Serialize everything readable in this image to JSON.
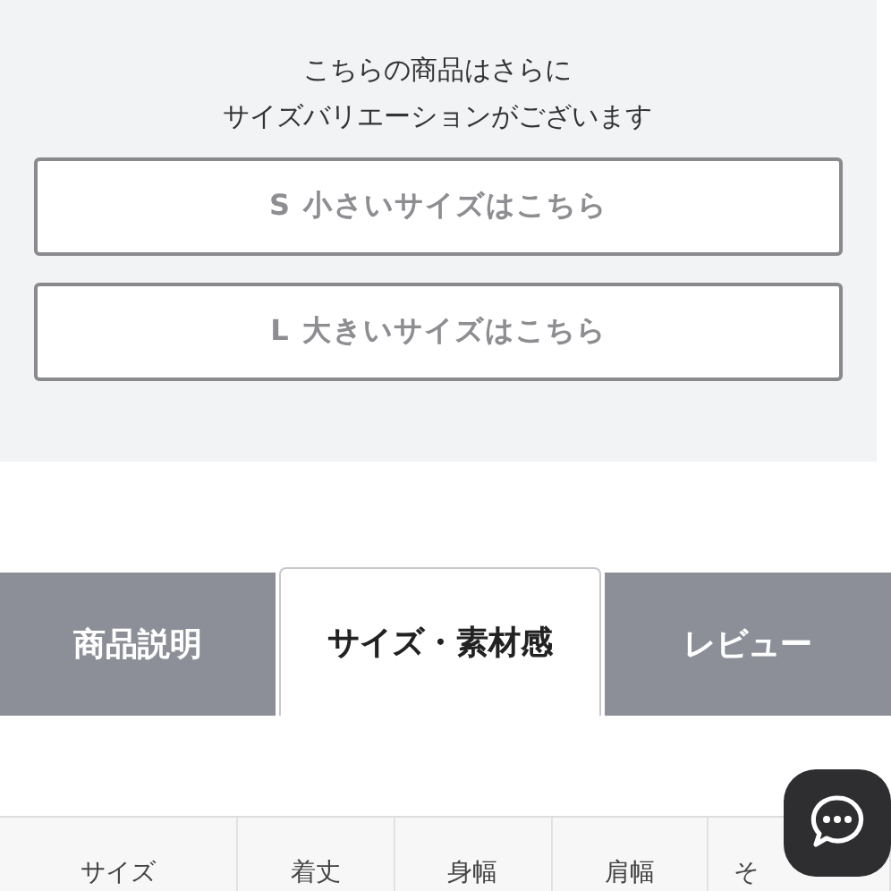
{
  "variation_notice": {
    "lines": [
      "こちらの商品はさらに",
      "サイズバリエーションがございます"
    ],
    "buttons": [
      "S 小さいサイズはこちら",
      "L 大きいサイズはこちら"
    ]
  },
  "tabs": [
    {
      "label": "商品説明",
      "selected": false
    },
    {
      "label": "サイズ・素材感",
      "selected": true
    },
    {
      "label": "レビュー",
      "selected": false
    }
  ],
  "size_table": {
    "columns": [
      "サイズ",
      "着丈",
      "身幅",
      "肩幅",
      "そ"
    ]
  }
}
